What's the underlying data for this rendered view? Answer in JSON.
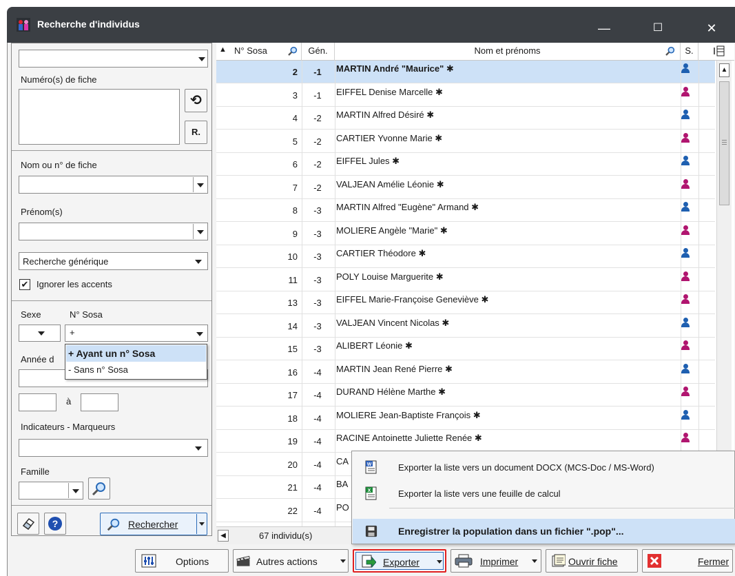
{
  "window": {
    "title": "Recherche d'individus",
    "minimize": "—",
    "maximize": "☐",
    "close": "✕"
  },
  "left": {
    "top_combo_value": "",
    "fiche_label": "Numéro(s) de fiche",
    "refresh_btn": "⟲",
    "r_btn": "R.",
    "nom_label": "Nom  ou  n° de fiche",
    "prenom_label": "Prénom(s)",
    "generic_value": "Recherche générique",
    "ignore_accents": "Ignorer les accents",
    "sexe_label": "Sexe",
    "sosa_label": "N° Sosa",
    "sosa_value": "+",
    "annee_label": "Année d",
    "a_label": "à",
    "indicateurs_label": "Indicateurs - Marqueurs",
    "famille_label": "Famille",
    "rechercher": "Rechercher"
  },
  "sosa_dropdown": {
    "items": [
      "+ Ayant un n° Sosa",
      "- Sans n° Sosa"
    ]
  },
  "grid": {
    "headers": {
      "sosa": "N° Sosa",
      "gen": "Gén.",
      "name": "Nom et prénoms",
      "sex": "S."
    },
    "rows": [
      {
        "sosa": "2",
        "gen": "-1",
        "name": "MARTIN André \"Maurice\" ✱",
        "sex": "m"
      },
      {
        "sosa": "3",
        "gen": "-1",
        "name": "EIFFEL Denise Marcelle ✱",
        "sex": "f"
      },
      {
        "sosa": "4",
        "gen": "-2",
        "name": "MARTIN Alfred Désiré ✱",
        "sex": "m"
      },
      {
        "sosa": "5",
        "gen": "-2",
        "name": "CARTIER Yvonne Marie ✱",
        "sex": "f"
      },
      {
        "sosa": "6",
        "gen": "-2",
        "name": "EIFFEL Jules ✱",
        "sex": "m"
      },
      {
        "sosa": "7",
        "gen": "-2",
        "name": "VALJEAN Amélie Léonie ✱",
        "sex": "f"
      },
      {
        "sosa": "8",
        "gen": "-3",
        "name": "MARTIN Alfred \"Eugène\" Armand ✱",
        "sex": "m"
      },
      {
        "sosa": "9",
        "gen": "-3",
        "name": "MOLIERE Angèle \"Marie\" ✱",
        "sex": "f"
      },
      {
        "sosa": "10",
        "gen": "-3",
        "name": "CARTIER Théodore ✱",
        "sex": "m"
      },
      {
        "sosa": "11",
        "gen": "-3",
        "name": "POLY Louise Marguerite ✱",
        "sex": "f"
      },
      {
        "sosa": "13",
        "gen": "-3",
        "name": "EIFFEL Marie-Françoise Geneviève ✱",
        "sex": "f"
      },
      {
        "sosa": "14",
        "gen": "-3",
        "name": "VALJEAN Vincent Nicolas ✱",
        "sex": "m"
      },
      {
        "sosa": "15",
        "gen": "-3",
        "name": "ALIBERT Léonie ✱",
        "sex": "f"
      },
      {
        "sosa": "16",
        "gen": "-4",
        "name": "MARTIN Jean René Pierre ✱",
        "sex": "m"
      },
      {
        "sosa": "17",
        "gen": "-4",
        "name": "DURAND Hélène Marthe ✱",
        "sex": "f"
      },
      {
        "sosa": "18",
        "gen": "-4",
        "name": "MOLIERE Jean-Baptiste François ✱",
        "sex": "m"
      },
      {
        "sosa": "19",
        "gen": "-4",
        "name": "RACINE Antoinette Juliette Renée ✱",
        "sex": "f"
      },
      {
        "sosa": "20",
        "gen": "-4",
        "name": "CA",
        "sex": ""
      },
      {
        "sosa": "21",
        "gen": "-4",
        "name": "BA",
        "sex": ""
      },
      {
        "sosa": "22",
        "gen": "-4",
        "name": "PO",
        "sex": ""
      }
    ],
    "count": "67 individu(s)"
  },
  "export_menu": {
    "items": [
      "Exporter la liste vers un document DOCX (MCS-Doc / MS-Word)",
      "Exporter la liste vers une feuille de calcul",
      "Enregistrer la population dans un fichier \".pop\"..."
    ]
  },
  "bottom": {
    "options": "Options",
    "autres": "Autres actions",
    "exporter": "Exporter",
    "imprimer": "Imprimer",
    "ouvrir": "Ouvrir fiche",
    "fermer": "Fermer"
  }
}
